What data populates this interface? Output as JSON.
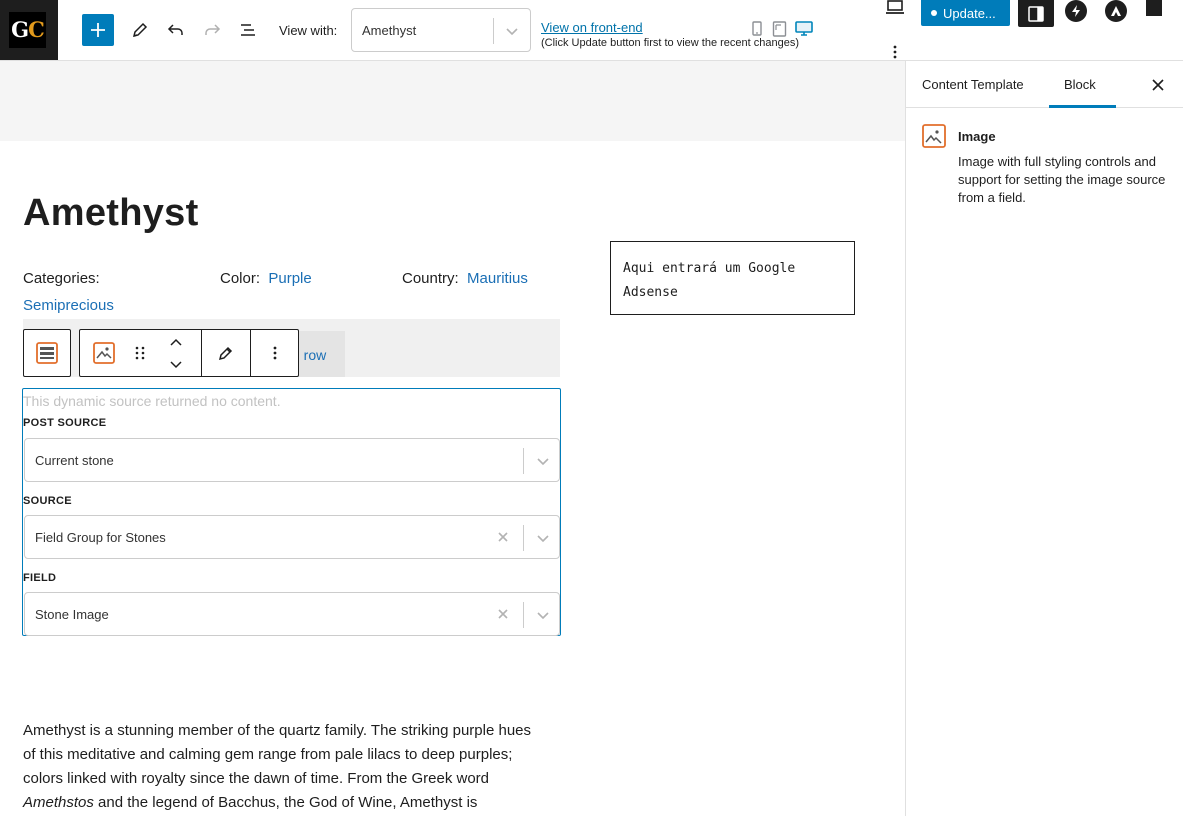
{
  "header": {
    "logo_text_g": "G",
    "logo_text_c": "C",
    "view_with_label": "View with:",
    "view_with_value": "Amethyst",
    "frontend_link": "View on front-end",
    "frontend_hint": "(Click Update button first to view the recent changes)",
    "update_label": "Update..."
  },
  "post": {
    "title": "Amethyst",
    "categories_label": "Categories:",
    "categories_value": "Semiprecious",
    "color_label": "Color:",
    "color_value": "Purple",
    "country_label": "Country:",
    "country_value": "Mauritius",
    "ad_text": "Aqui entrará um Google Adsense",
    "add_row_fragment": "d row"
  },
  "block": {
    "empty_message": "This dynamic source returned no content.",
    "fields": [
      {
        "label": "POST SOURCE",
        "value": "Current stone",
        "clearable": false
      },
      {
        "label": "SOURCE",
        "value": "Field Group for Stones",
        "clearable": true
      },
      {
        "label": "FIELD",
        "value": "Stone Image",
        "clearable": true
      }
    ]
  },
  "paragraph": {
    "part1": "Amethyst is a stunning member of the quartz family. The striking purple hues of this meditative and calming gem range from pale lilacs to deep purples; colors linked with royalty since the dawn of time. From the Greek word ",
    "italic": "Amethstos",
    "part2": " and the legend of Bacchus, the God of Wine, Amethyst is"
  },
  "sidebar": {
    "tabs": [
      "Content Template",
      "Block"
    ],
    "active_tab": "Block",
    "block_title": "Image",
    "block_description": "Image with full styling controls and support for setting the image source from a field."
  },
  "colors": {
    "accent": "#007cba",
    "link": "#1b6fb5",
    "image_icon": "#e26f2c"
  }
}
